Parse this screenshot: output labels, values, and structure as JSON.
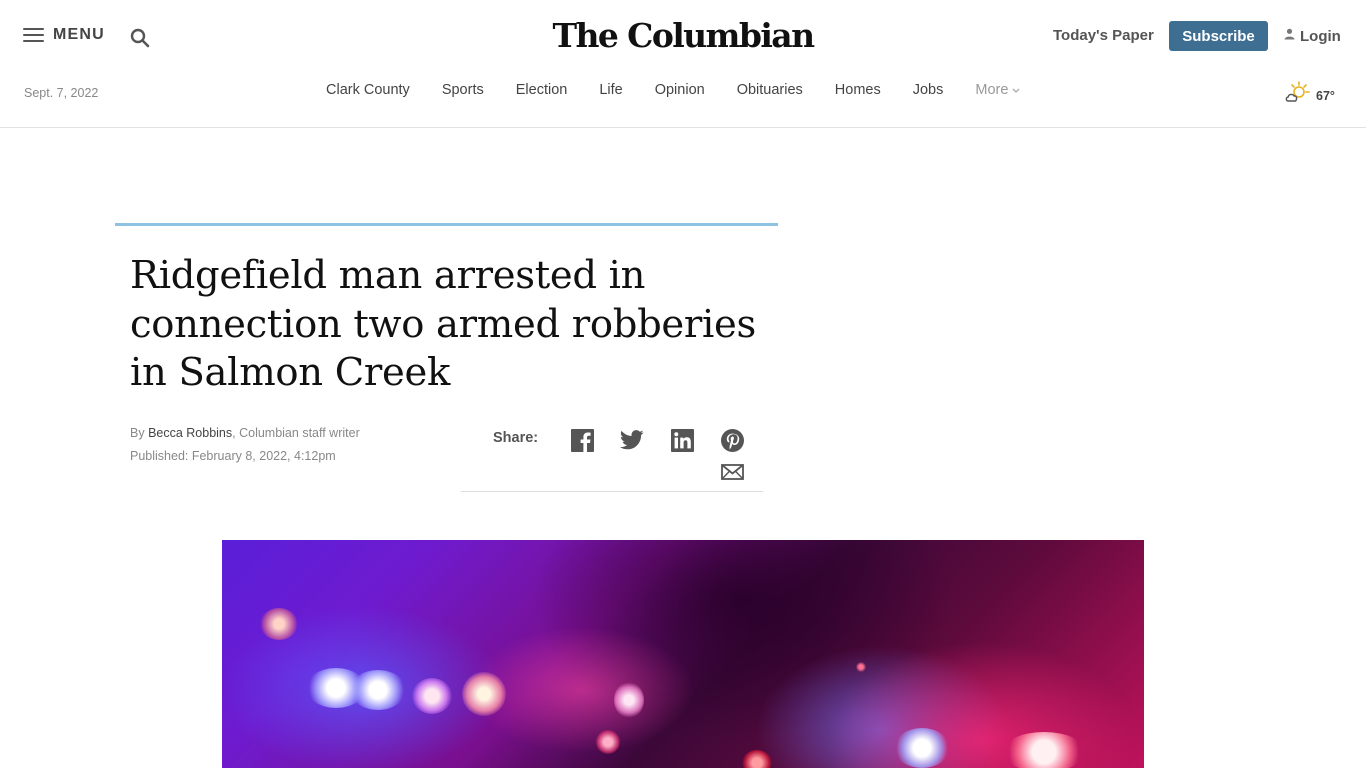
{
  "header": {
    "menu_label": "MENU",
    "logo_text": "The Columbian",
    "todays_paper": "Today's Paper",
    "subscribe": "Subscribe",
    "login": "Login",
    "icons": [
      "hamburger-icon",
      "search-icon",
      "user-icon"
    ]
  },
  "nav": {
    "date": "Sept. 7, 2022",
    "items": [
      "Clark County",
      "Sports",
      "Election",
      "Life",
      "Opinion",
      "Obituaries",
      "Homes",
      "Jobs"
    ],
    "more": "More",
    "weather": {
      "temp": "67°",
      "icon": "partly-cloudy-icon"
    }
  },
  "article": {
    "headline": "Ridgefield man arrested in connection two armed robberies in Salmon Creek",
    "byline_prefix": "By ",
    "author": "Becca Robbins",
    "author_role": ", Columbian staff writer",
    "published": "Published: February 8, 2022, 4:12pm",
    "share_label": "Share:",
    "share_icons": [
      "facebook-icon",
      "twitter-icon",
      "linkedin-icon",
      "pinterest-icon",
      "email-icon"
    ]
  },
  "colors": {
    "subscribe_bg": "#3e6f93",
    "accent_line": "#8ec2e2",
    "weather_sun": "#e8b320"
  }
}
